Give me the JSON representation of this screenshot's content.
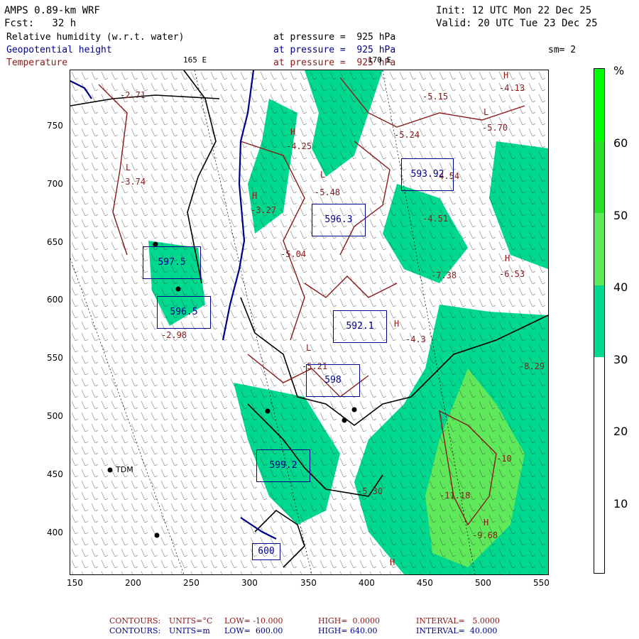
{
  "header": {
    "model": "AMPS 0.89-km WRF",
    "init": "Init: 12 UTC Mon 22 Dec 25",
    "fcst": "Fcst:   32 h",
    "valid": "Valid: 20 UTC Tue 23 Dec 25",
    "field1": "Relative humidity (w.r.t. water)",
    "field1_level": "at pressure =  925 hPa",
    "field2": "Geopotential height",
    "field2_level": "at pressure =  925 hPa",
    "field3": "Temperature",
    "field3_level": "at pressure =  925 hPa",
    "smoothing": "sm= 2",
    "lon_label_1": "165 E",
    "lon_label_2": "170 E"
  },
  "colors": {
    "rh_fill_30_40": "#00d88e",
    "rh_fill_40_50": "#5ee85a",
    "rh_fill_50_60": "#28e028",
    "rh_fill_60_plus": "#00ff00",
    "temperature_contour": "#8b1a1a",
    "height_contour": "#00008b",
    "coastline": "#000000"
  },
  "colorbar": {
    "unit": "%",
    "labels": [
      "60",
      "50",
      "40",
      "30",
      "20",
      "10"
    ]
  },
  "axes": {
    "x_ticks": [
      "150",
      "200",
      "250",
      "300",
      "350",
      "400",
      "450",
      "500",
      "550"
    ],
    "y_ticks": [
      "750",
      "700",
      "650",
      "600",
      "550",
      "500",
      "450",
      "400"
    ]
  },
  "station": {
    "name": "TDM"
  },
  "annotations": {
    "temperature_values": [
      "-2.71",
      "-3.74",
      "-4.25",
      "-3.27",
      "-5.48",
      "-5.04",
      "-5.15",
      "-5.24",
      "-5.70",
      "-4.13",
      "-4.54",
      "-4.51",
      "-7.38",
      "-6.53",
      "-2.98",
      "-4.3",
      "-5.21",
      "-8.29",
      "-11.18",
      "-9.68",
      "-10",
      "-5.30"
    ],
    "height_values": [
      "593.92",
      "596.3",
      "597.5",
      "596.5",
      "592.1",
      "599.2",
      "598",
      "600"
    ],
    "highs": [
      "H",
      "H",
      "H",
      "H",
      "H",
      "H",
      "H"
    ],
    "lows": [
      "L",
      "L",
      "L",
      "L"
    ]
  },
  "footer": {
    "line1_label": "CONTOURS:",
    "line1_units": "UNITS=°C",
    "line1_low": "LOW= -10.000",
    "line1_high": "HIGH=  0.0000",
    "line1_interval": "INTERVAL=   5.0000",
    "line2_label": "CONTOURS:",
    "line2_units": "UNITS=m",
    "line2_low": "LOW=  600.00",
    "line2_high": "HIGH= 640.00",
    "line2_interval": "INTERVAL=  40.000"
  }
}
